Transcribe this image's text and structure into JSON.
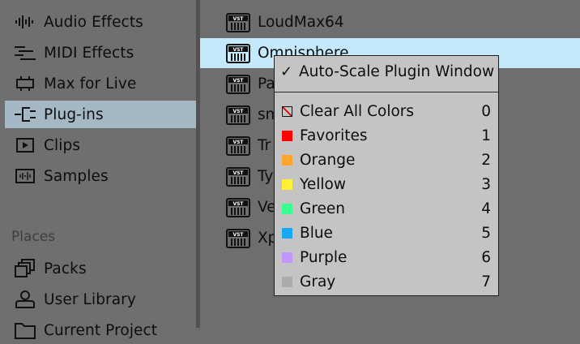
{
  "sidebar": {
    "items": [
      {
        "label": "Audio Effects",
        "icon": "audio-effects-icon"
      },
      {
        "label": "MIDI Effects",
        "icon": "midi-effects-icon"
      },
      {
        "label": "Max for Live",
        "icon": "max-for-live-icon"
      },
      {
        "label": "Plug-ins",
        "icon": "plugin-icon",
        "selected": true
      },
      {
        "label": "Clips",
        "icon": "clips-icon"
      },
      {
        "label": "Samples",
        "icon": "samples-icon"
      }
    ],
    "places_header": "Places",
    "places": [
      {
        "label": "Packs",
        "icon": "packs-icon"
      },
      {
        "label": "User Library",
        "icon": "user-library-icon"
      },
      {
        "label": "Current Project",
        "icon": "folder-icon"
      }
    ]
  },
  "plugins": [
    {
      "label": "LoudMax64"
    },
    {
      "label": "Omnisphere",
      "selected": true
    },
    {
      "label": "Pa"
    },
    {
      "label": "sm"
    },
    {
      "label": "Tr"
    },
    {
      "label": "Ty"
    },
    {
      "label": "Ve"
    },
    {
      "label": "Xp"
    }
  ],
  "context_menu": {
    "auto_scale": {
      "label": "Auto-Scale Plugin Window",
      "checked": true
    },
    "colors": [
      {
        "label": "Clear All Colors",
        "shortcut": "0",
        "color": "clear"
      },
      {
        "label": "Favorites",
        "shortcut": "1",
        "color": "#ff0000"
      },
      {
        "label": "Orange",
        "shortcut": "2",
        "color": "#ffa52b"
      },
      {
        "label": "Yellow",
        "shortcut": "3",
        "color": "#fff034"
      },
      {
        "label": "Green",
        "shortcut": "4",
        "color": "#3cff92"
      },
      {
        "label": "Blue",
        "shortcut": "5",
        "color": "#17a9f6"
      },
      {
        "label": "Purple",
        "shortcut": "6",
        "color": "#c197fb"
      },
      {
        "label": "Gray",
        "shortcut": "7",
        "color": "#ababab"
      }
    ]
  },
  "colors": {
    "selection_blue": "#c4e9fa",
    "sidebar_selected": "#a5b9c5",
    "menu_bg": "#c4c4c4"
  }
}
